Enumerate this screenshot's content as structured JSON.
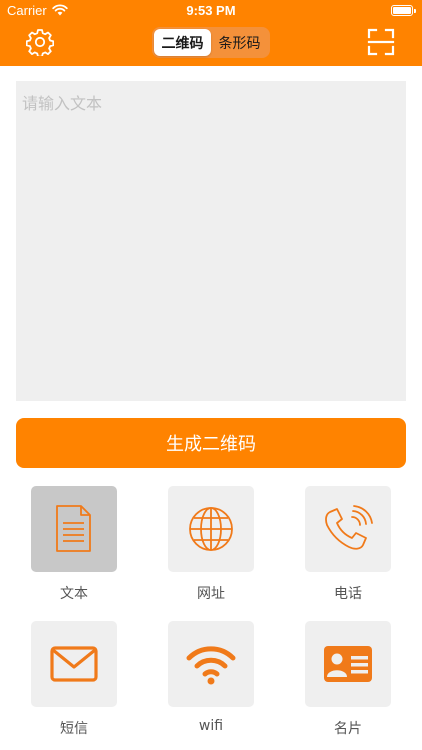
{
  "status_bar": {
    "carrier": "Carrier",
    "time": "9:53 PM"
  },
  "nav": {
    "segments": [
      {
        "label": "二维码",
        "active": true
      },
      {
        "label": "条形码",
        "active": false
      }
    ]
  },
  "input": {
    "placeholder": "请输入文本",
    "value": ""
  },
  "generate_button": {
    "label": "生成二维码"
  },
  "types": [
    {
      "label": "文本",
      "icon": "document-icon",
      "selected": true
    },
    {
      "label": "网址",
      "icon": "globe-icon",
      "selected": false
    },
    {
      "label": "电话",
      "icon": "phone-icon",
      "selected": false
    },
    {
      "label": "短信",
      "icon": "envelope-icon",
      "selected": false
    },
    {
      "label": "wifi",
      "icon": "wifi-icon",
      "selected": false
    },
    {
      "label": "名片",
      "icon": "business-card-icon",
      "selected": false
    }
  ],
  "colors": {
    "accent": "#FF8300",
    "tile": "#EFEFEF",
    "tile_selected": "#C8C8C8"
  }
}
